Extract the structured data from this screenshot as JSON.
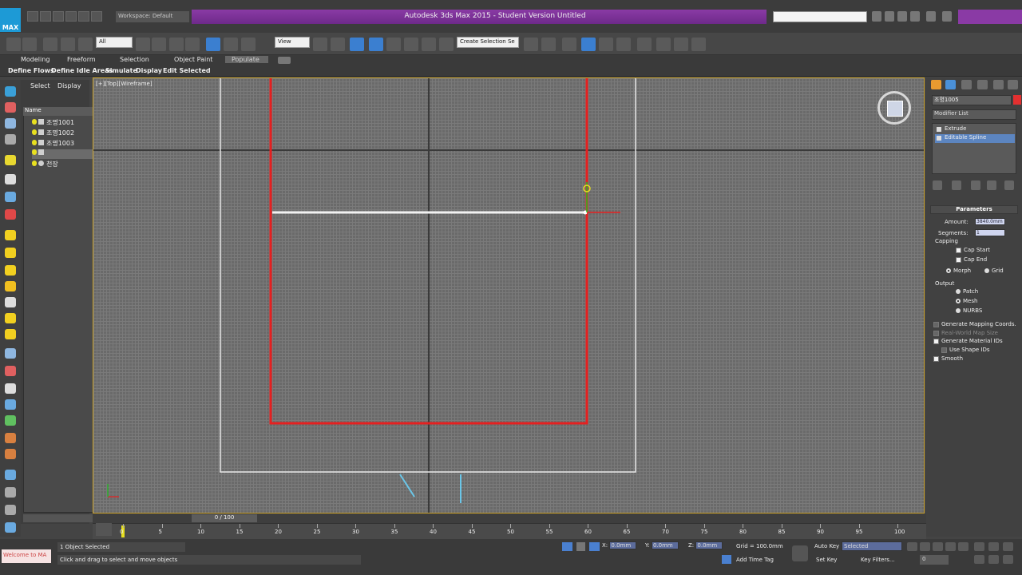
{
  "app": {
    "title": "Autodesk 3ds Max  2015  - Student Version   Untitled",
    "workspace": "Workspace: Default",
    "logo": "MAX"
  },
  "toolbar": {
    "selection_filter": "All",
    "view_dropdown": "View",
    "named_selection": "Create Selection Se"
  },
  "ribbon": {
    "tabs": [
      "Modeling",
      "Freeform",
      "Selection",
      "Object Paint",
      "Populate"
    ],
    "subtabs": [
      "Define Flows",
      "Define Idle Areas",
      "Simulate",
      "Display",
      "Edit Selected"
    ]
  },
  "scene_explorer": {
    "tabs": [
      "Select",
      "Display"
    ],
    "column_header": "Name",
    "items": [
      "조명1001",
      "조명1002",
      "조명1003",
      "",
      "천장"
    ]
  },
  "viewport": {
    "label": "[+][Top][Wireframe]"
  },
  "command_panel": {
    "object_name": "조명1005",
    "object_color": "#e33030",
    "modifier_list": "Modifier List",
    "stack": [
      "Extrude",
      "Editable Spline"
    ],
    "parameters": {
      "header": "Parameters",
      "amount_label": "Amount:",
      "amount_value": "3840.0mm",
      "segments_label": "Segments:",
      "segments_value": "1",
      "capping_label": "Capping",
      "cap_start": "Cap Start",
      "cap_end": "Cap End",
      "morph": "Morph",
      "grid": "Grid",
      "output_label": "Output",
      "patch": "Patch",
      "mesh": "Mesh",
      "nurbs": "NURBS",
      "gen_mapping": "Generate Mapping Coords.",
      "real_world": "Real-World Map Size",
      "gen_material": "Generate Material IDs",
      "use_shape": "Use Shape IDs",
      "smooth": "Smooth"
    }
  },
  "timeline": {
    "slider": "0 / 100",
    "ticks": [
      "0",
      "5",
      "10",
      "15",
      "20",
      "25",
      "30",
      "35",
      "40",
      "45",
      "50",
      "55",
      "60",
      "65",
      "70",
      "75",
      "80",
      "85",
      "90",
      "95",
      "100"
    ]
  },
  "status": {
    "maxscript": "Welcome to MA",
    "selection": "1 Object Selected",
    "prompt": "Click and drag to select and move objects",
    "x_label": "X:",
    "x_value": "0.0mm",
    "y_label": "Y:",
    "y_value": "0.0mm",
    "z_label": "Z:",
    "z_value": "0.0mm",
    "grid": "Grid = 100.0mm",
    "add_time_tag": "Add Time Tag",
    "auto_key": "Auto Key",
    "set_key": "Set Key",
    "key_mode": "Selected",
    "key_filters": "Key Filters...",
    "frame": "0"
  }
}
